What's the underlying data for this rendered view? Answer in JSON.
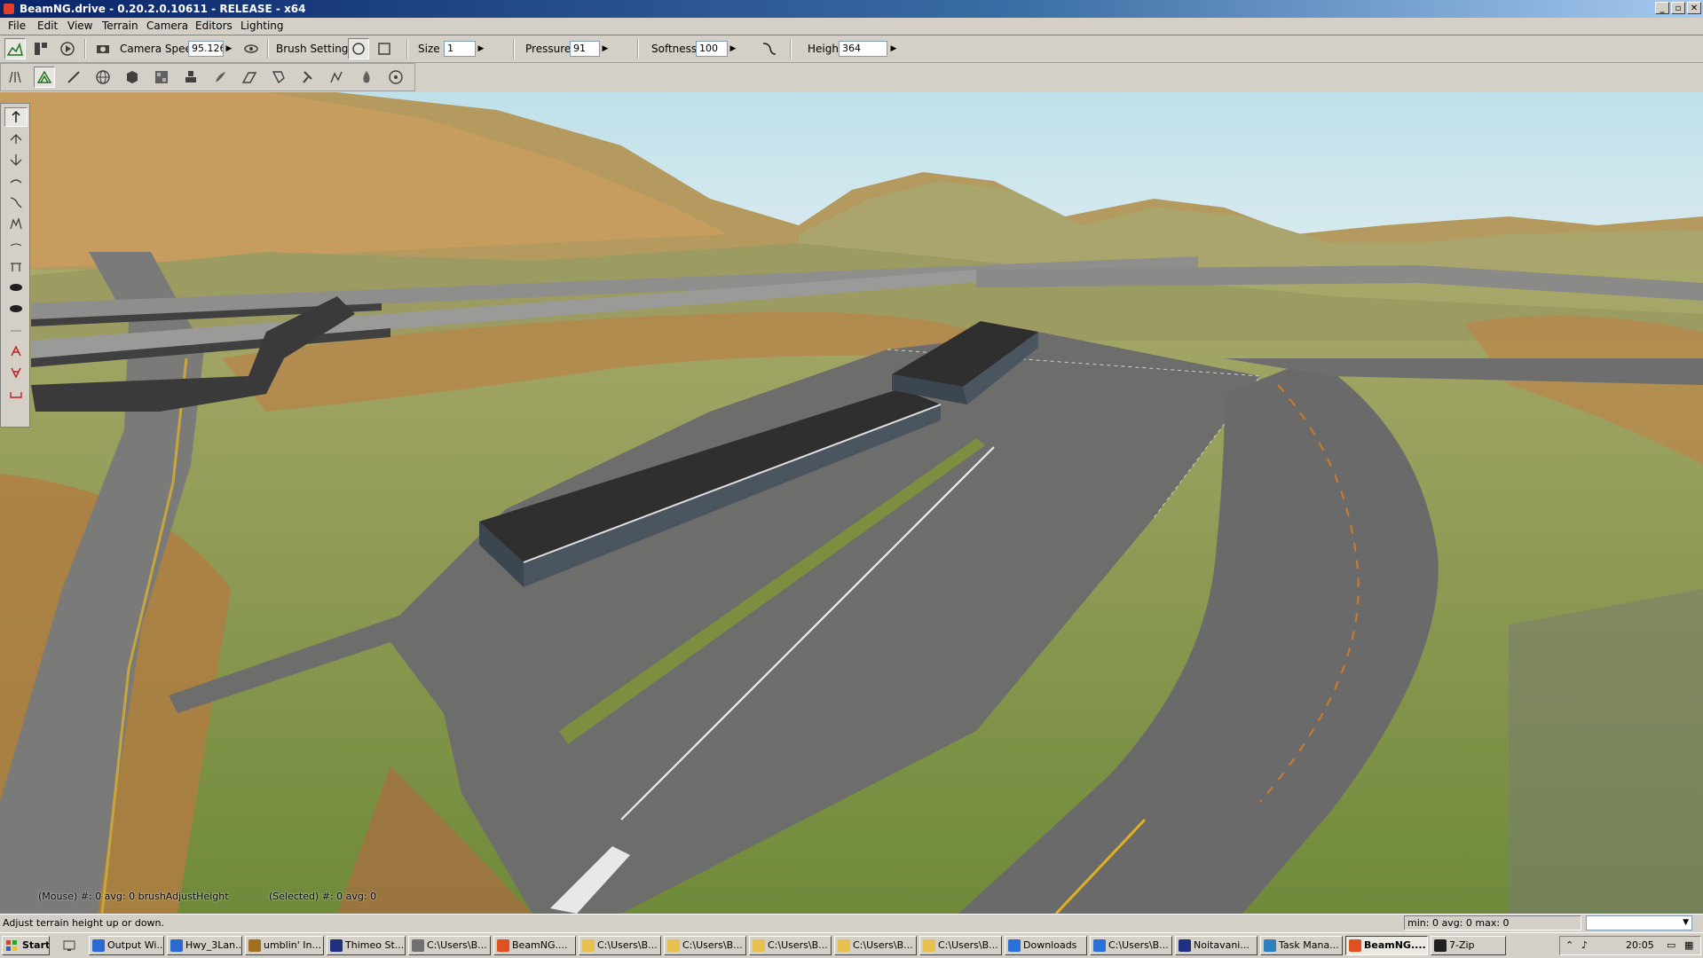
{
  "window": {
    "title": "BeamNG.drive - 0.20.2.0.10611 - RELEASE - x64",
    "buttons": [
      "_",
      "▫",
      "✕"
    ]
  },
  "menu": {
    "items": [
      "File",
      "Edit",
      "View",
      "Terrain",
      "Camera",
      "Editors",
      "Lighting"
    ]
  },
  "toolbar": {
    "camera_speed_label": "Camera Speed",
    "camera_speed_value": "95.126",
    "brush_settings_label": "Brush Settings",
    "size_label": "Size",
    "size_value": "1",
    "pressure_label": "Pressure",
    "pressure_value": "91",
    "softness_label": "Softness",
    "softness_value": "100",
    "height_label": "Height",
    "height_value": "364"
  },
  "overlay": {
    "mouse_info": "(Mouse) #: 0  avg: 0 brushAdjustHeight",
    "selected_info": "(Selected) #: 0  avg: 0"
  },
  "status": {
    "hint": "Adjust terrain height up or down.",
    "stats": "min: 0  avg: 0  max: 0",
    "combo_arrow": "▼"
  },
  "taskbar": {
    "start": "Start",
    "tasks": [
      {
        "label": "Output Wi...",
        "icon": "window-icon",
        "color": "#2a6ad0"
      },
      {
        "label": "Hwy_3Lan...",
        "icon": "window-icon",
        "color": "#2a6ad0"
      },
      {
        "label": "umblin' In...",
        "icon": "pen-icon",
        "color": "#a07020"
      },
      {
        "label": "Thimeo St...",
        "icon": "window-icon",
        "color": "#203080"
      },
      {
        "label": "C:\\Users\\B...",
        "icon": "notepad-icon",
        "color": "#707070"
      },
      {
        "label": "BeamNG....",
        "icon": "browser-icon",
        "color": "#e05020"
      },
      {
        "label": "C:\\Users\\B...",
        "icon": "folder-icon",
        "color": "#e8c050"
      },
      {
        "label": "C:\\Users\\B...",
        "icon": "folder-icon",
        "color": "#e8c050"
      },
      {
        "label": "C:\\Users\\B...",
        "icon": "folder-icon",
        "color": "#e8c050"
      },
      {
        "label": "C:\\Users\\B...",
        "icon": "folder-icon",
        "color": "#e8c050"
      },
      {
        "label": "C:\\Users\\B...",
        "icon": "folder-icon",
        "color": "#e8c050"
      },
      {
        "label": "Downloads",
        "icon": "download-icon",
        "color": "#2a70d8"
      },
      {
        "label": "C:\\Users\\B...",
        "icon": "download-icon",
        "color": "#2a70d8"
      },
      {
        "label": "Noitavani...",
        "icon": "document-icon",
        "color": "#203080"
      },
      {
        "label": "Task Mana...",
        "icon": "task-manager-icon",
        "color": "#3080c0"
      },
      {
        "label": "BeamNG....",
        "icon": "beamng-icon",
        "color": "#e05020",
        "active": true
      },
      {
        "label": "7-Zip",
        "icon": "zip-icon",
        "color": "#202020"
      }
    ],
    "clock": "20:05"
  },
  "colors": {
    "sky_top": "#bfe0ea",
    "sky_bottom": "#d9ebf1",
    "terrain_grass": "#8f9c4e",
    "terrain_dry": "#c58b4c",
    "asphalt": "#6b6b6b",
    "roof": "#2f2f2f"
  }
}
